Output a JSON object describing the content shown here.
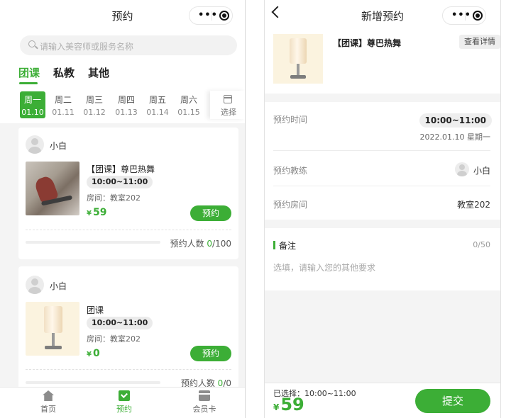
{
  "colors": {
    "accent": "#3cae36",
    "background": "#f4f4f4",
    "card": "#ffffff"
  },
  "left": {
    "nav_title": "预约",
    "search_placeholder": "请输入美容师或服务名称",
    "categories": [
      "团课",
      "私教",
      "其他"
    ],
    "active_category": "团课",
    "week": [
      {
        "day": "周一",
        "date": "01.10",
        "active": true
      },
      {
        "day": "周二",
        "date": "01.11"
      },
      {
        "day": "周三",
        "date": "01.12"
      },
      {
        "day": "周四",
        "date": "01.13"
      },
      {
        "day": "周五",
        "date": "01.14"
      },
      {
        "day": "周六",
        "date": "01.15"
      }
    ],
    "calendar_label": "选择",
    "courses": [
      {
        "coach": "小白",
        "title": "【团课】尊巴热舞",
        "time": "10:00~11:00",
        "room": "房间：教室202",
        "currency": "¥",
        "price": "59",
        "book_label": "预约",
        "count_label": "预约人数 ",
        "booked": "0",
        "capacity": "/100",
        "image": "dance-image"
      },
      {
        "coach": "小白",
        "title": "团课",
        "time": "10:00~11:00",
        "room": "房间：教室202",
        "currency": "¥",
        "price": "0",
        "book_label": "预约",
        "count_label": "预约人数 ",
        "booked": "0",
        "capacity": "/0",
        "image": "lamp-image"
      }
    ],
    "tabbar": [
      {
        "label": "首页",
        "icon": "home-icon"
      },
      {
        "label": "预约",
        "icon": "booking-icon",
        "active": true
      },
      {
        "label": "会员卡",
        "icon": "card-icon"
      }
    ]
  },
  "right": {
    "nav_title": "新增预约",
    "course_title": "【团课】尊巴热舞",
    "detail_label": "查看详情",
    "time_label": "预约时间",
    "time_value": "10:00~11:00",
    "date_value": "2022.01.10 星期一",
    "coach_label": "预约教练",
    "coach_value": "小白",
    "room_label": "预约房间",
    "room_value": "教室202",
    "note_label": "备注",
    "note_count": "0/50",
    "note_placeholder": "选填，请输入您的其他要求",
    "selected_text": "已选择：10:00~11:00",
    "currency": "¥",
    "total": "59",
    "submit_label": "提交"
  }
}
